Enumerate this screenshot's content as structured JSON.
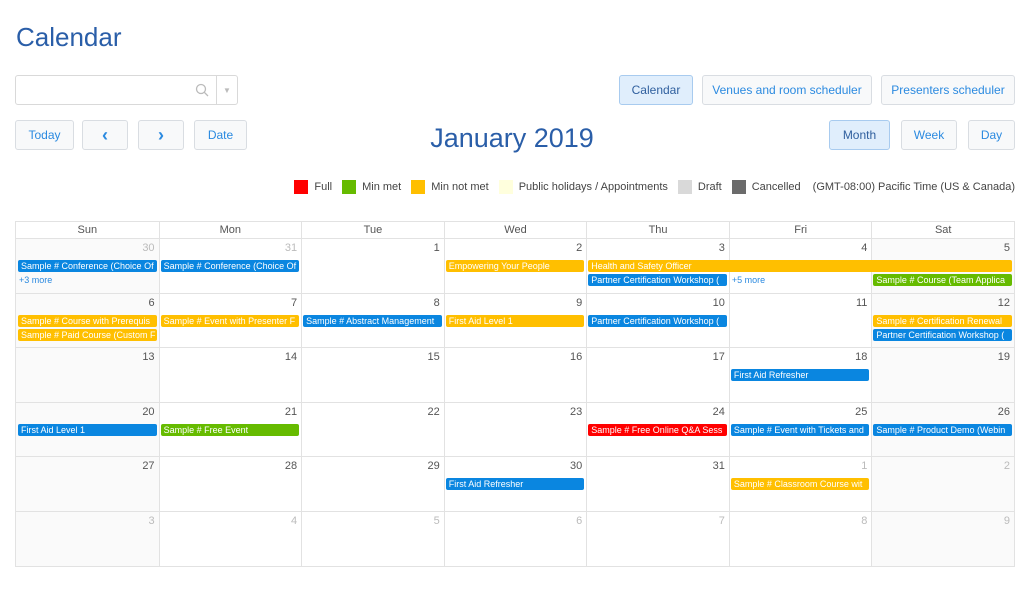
{
  "header": {
    "title": "Calendar",
    "month_title": "January 2019"
  },
  "search": {
    "placeholder": "",
    "value": ""
  },
  "view_switch": {
    "calendar": "Calendar",
    "venues": "Venues and room scheduler",
    "presenters": "Presenters scheduler"
  },
  "nav": {
    "today": "Today",
    "prev": "‹",
    "next": "›",
    "date": "Date"
  },
  "mode": {
    "month": "Month",
    "week": "Week",
    "day": "Day"
  },
  "colors": {
    "full": "#ff0000",
    "min_met": "#66bb00",
    "min_not_met": "#ffbf00",
    "holidays": "#ffffdd",
    "draft": "#d9d9d9",
    "cancelled": "#6b6b6b",
    "blue": "#0a86e0"
  },
  "legend": [
    {
      "label": "Full",
      "color": "#ff0000"
    },
    {
      "label": "Min met",
      "color": "#66bb00"
    },
    {
      "label": "Min not met",
      "color": "#ffbf00"
    },
    {
      "label": "Public holidays / Appointments",
      "color": "#ffffdd"
    },
    {
      "label": "Draft",
      "color": "#d9d9d9"
    },
    {
      "label": "Cancelled",
      "color": "#6b6b6b"
    }
  ],
  "timezone": "(GMT-08:00) Pacific Time (US & Canada)",
  "weekdays": [
    "Sun",
    "Mon",
    "Tue",
    "Wed",
    "Thu",
    "Fri",
    "Sat"
  ],
  "weeks": [
    {
      "days": [
        {
          "n": "30",
          "other": true
        },
        {
          "n": "31",
          "other": true
        },
        {
          "n": "1"
        },
        {
          "n": "2"
        },
        {
          "n": "3"
        },
        {
          "n": "4"
        },
        {
          "n": "5"
        }
      ],
      "events": [
        {
          "title": "Sample # Conference (Choice Of",
          "start": 0,
          "span": 1,
          "row": 0,
          "color": "blue"
        },
        {
          "title": "Sample # Conference (Choice Of",
          "start": 1,
          "span": 1,
          "row": 0,
          "color": "blue"
        },
        {
          "title": "Empowering Your People",
          "start": 3,
          "span": 1,
          "row": 0,
          "color": "min_not_met"
        },
        {
          "title": "Health and Safety Officer",
          "start": 4,
          "span": 3,
          "row": 0,
          "color": "min_not_met"
        },
        {
          "title": "Partner Certification Workshop (",
          "start": 4,
          "span": 1,
          "row": 1,
          "color": "blue"
        },
        {
          "title": "Sample # Course (Team Applica",
          "start": 6,
          "span": 1,
          "row": 1,
          "color": "min_met"
        }
      ],
      "more": [
        {
          "label": "+3 more",
          "col": 0,
          "row": 1
        },
        {
          "label": "+5 more",
          "col": 5,
          "row": 1
        }
      ]
    },
    {
      "days": [
        {
          "n": "6"
        },
        {
          "n": "7"
        },
        {
          "n": "8"
        },
        {
          "n": "9"
        },
        {
          "n": "10"
        },
        {
          "n": "11"
        },
        {
          "n": "12"
        }
      ],
      "events": [
        {
          "title": "Sample # Course with Prerequis",
          "start": 0,
          "span": 1,
          "row": 0,
          "color": "min_not_met"
        },
        {
          "title": "Sample # Paid Course (Custom F",
          "start": 0,
          "span": 1,
          "row": 1,
          "color": "min_not_met"
        },
        {
          "title": "Sample # Event with Presenter F",
          "start": 1,
          "span": 1,
          "row": 0,
          "color": "min_not_met"
        },
        {
          "title": "Sample # Abstract Management",
          "start": 2,
          "span": 1,
          "row": 0,
          "color": "blue"
        },
        {
          "title": "First Aid Level 1",
          "start": 3,
          "span": 1,
          "row": 0,
          "color": "min_not_met"
        },
        {
          "title": "Partner Certification Workshop (",
          "start": 4,
          "span": 1,
          "row": 0,
          "color": "blue"
        },
        {
          "title": "Sample # Certification Renewal",
          "start": 6,
          "span": 1,
          "row": 0,
          "color": "min_not_met"
        },
        {
          "title": "Partner Certification Workshop (",
          "start": 6,
          "span": 1,
          "row": 1,
          "color": "blue"
        }
      ],
      "more": []
    },
    {
      "days": [
        {
          "n": "13"
        },
        {
          "n": "14"
        },
        {
          "n": "15"
        },
        {
          "n": "16"
        },
        {
          "n": "17"
        },
        {
          "n": "18"
        },
        {
          "n": "19"
        }
      ],
      "events": [
        {
          "title": "First Aid Refresher",
          "start": 5,
          "span": 1,
          "row": 0,
          "color": "blue"
        }
      ],
      "more": []
    },
    {
      "days": [
        {
          "n": "20"
        },
        {
          "n": "21"
        },
        {
          "n": "22"
        },
        {
          "n": "23"
        },
        {
          "n": "24"
        },
        {
          "n": "25"
        },
        {
          "n": "26"
        }
      ],
      "events": [
        {
          "title": "First Aid Level 1",
          "start": 0,
          "span": 1,
          "row": 0,
          "color": "blue"
        },
        {
          "title": "Sample # Free Event",
          "start": 1,
          "span": 1,
          "row": 0,
          "color": "min_met"
        },
        {
          "title": "Sample # Free Online Q&A Sess",
          "start": 4,
          "span": 1,
          "row": 0,
          "color": "full"
        },
        {
          "title": "Sample # Event with Tickets and",
          "start": 5,
          "span": 1,
          "row": 0,
          "color": "blue"
        },
        {
          "title": "Sample # Product Demo (Webin",
          "start": 6,
          "span": 1,
          "row": 0,
          "color": "blue"
        }
      ],
      "more": []
    },
    {
      "days": [
        {
          "n": "27"
        },
        {
          "n": "28"
        },
        {
          "n": "29"
        },
        {
          "n": "30"
        },
        {
          "n": "31"
        },
        {
          "n": "1",
          "other": true
        },
        {
          "n": "2",
          "other": true
        }
      ],
      "events": [
        {
          "title": "First Aid Refresher",
          "start": 3,
          "span": 1,
          "row": 0,
          "color": "blue"
        },
        {
          "title": "Sample # Classroom Course wit",
          "start": 5,
          "span": 1,
          "row": 0,
          "color": "min_not_met"
        }
      ],
      "more": []
    },
    {
      "days": [
        {
          "n": "3",
          "other": true
        },
        {
          "n": "4",
          "other": true
        },
        {
          "n": "5",
          "other": true
        },
        {
          "n": "6",
          "other": true
        },
        {
          "n": "7",
          "other": true
        },
        {
          "n": "8",
          "other": true
        },
        {
          "n": "9",
          "other": true
        }
      ],
      "events": [],
      "more": []
    }
  ]
}
